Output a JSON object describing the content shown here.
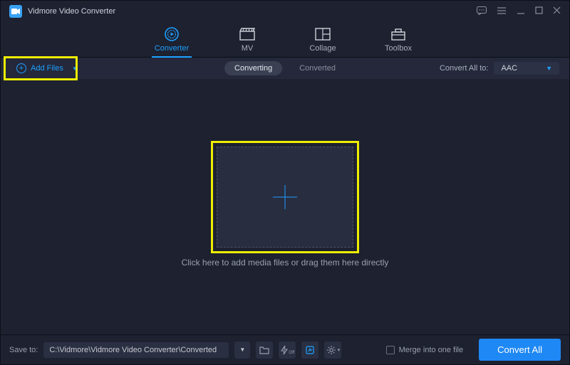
{
  "title": "Vidmore Video Converter",
  "nav": {
    "items": [
      {
        "label": "Converter",
        "icon": "play-circle-icon",
        "active": true
      },
      {
        "label": "MV",
        "icon": "clapper-icon",
        "active": false
      },
      {
        "label": "Collage",
        "icon": "collage-icon",
        "active": false
      },
      {
        "label": "Toolbox",
        "icon": "toolbox-icon",
        "active": false
      }
    ]
  },
  "subbar": {
    "add_files": "Add Files",
    "tab_converting": "Converting",
    "tab_converted": "Converted",
    "convert_all_label": "Convert All to:",
    "format": "AAC"
  },
  "main": {
    "hint": "Click here to add media files or drag them here directly"
  },
  "bottom": {
    "save_to_label": "Save to:",
    "path": "C:\\Vidmore\\Vidmore Video Converter\\Converted",
    "merge_label": "Merge into one file",
    "convert_button": "Convert All"
  },
  "colors": {
    "accent": "#1ea0ff",
    "highlight": "#eeee00"
  }
}
